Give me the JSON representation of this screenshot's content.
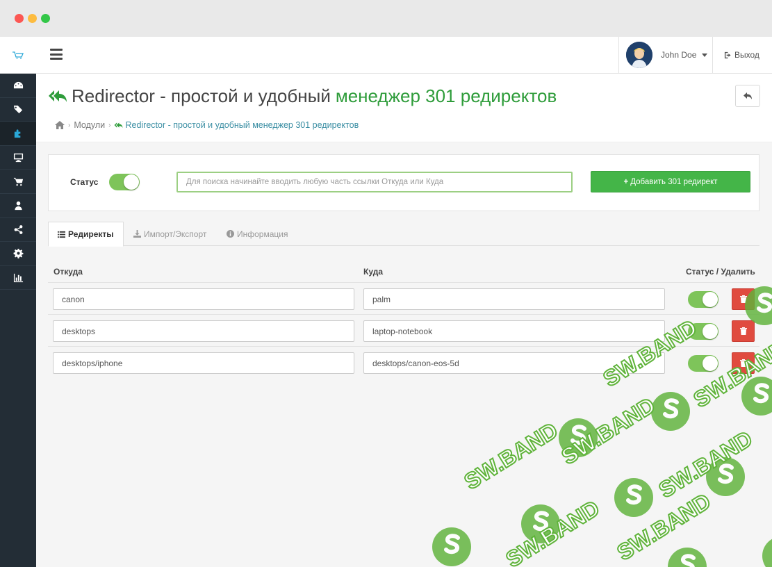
{
  "header": {
    "user_name": "John Doe",
    "logout_label": "Выход"
  },
  "page": {
    "title_main": "Redirector - простой и удобный",
    "title_accent": "менеджер 301 редиректов",
    "breadcrumb": {
      "modules": "Модули",
      "current": "Redirector - простой и удобный менеджер 301 редиректов"
    }
  },
  "panel": {
    "status_label": "Статус",
    "search_placeholder": "Для поиска начинайте вводить любую часть ссылки Откуда или Куда",
    "add_button": "Добавить 301 редирект"
  },
  "tabs": [
    {
      "label": "Редиректы",
      "icon": "list-icon"
    },
    {
      "label": "Импорт/Экспорт",
      "icon": "download-icon"
    },
    {
      "label": "Информация",
      "icon": "info-icon"
    }
  ],
  "table": {
    "columns": [
      "Откуда",
      "Куда",
      "Статус / Удалить"
    ],
    "rows": [
      {
        "from": "canon",
        "to": "palm",
        "status": "on"
      },
      {
        "from": "desktops",
        "to": "laptop-notebook",
        "status": "on"
      },
      {
        "from": "desktops/iphone",
        "to": "desktops/canon-eos-5d",
        "status": "on"
      }
    ]
  },
  "watermark": {
    "text": "SW.BAND"
  },
  "colors": {
    "accent_green": "#2e9c3a",
    "button_green": "#44b548",
    "toggle_on": "#7ec45a",
    "delete_red": "#e04b3f",
    "sidebar_bg": "#232d36",
    "link_blue": "#3a8ea3"
  }
}
